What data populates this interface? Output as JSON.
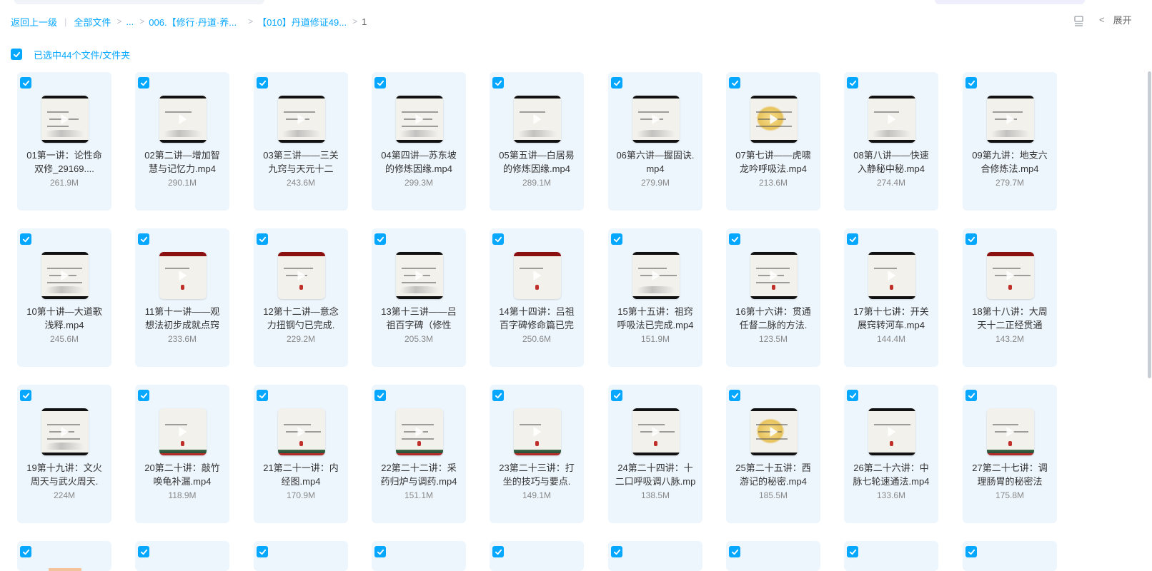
{
  "breadcrumb": {
    "back": "返回上一级",
    "all_files": "全部文件",
    "ellipsis": "...",
    "folder1": "006.【修行·丹道·养...",
    "folder2": "【010】丹道修证49...",
    "current": "1"
  },
  "header": {
    "expand_label": "展开",
    "view_icon": "list-view-icon"
  },
  "selection": {
    "text": "已选中44个文件/文件夹"
  },
  "colors": {
    "accent": "#06a7ff",
    "tile_bg": "#eef6fd"
  },
  "files": [
    {
      "name": "01第一讲：论性命双修_29169....",
      "size": "261.9M",
      "style": "plain"
    },
    {
      "name": "02第二讲—增加智慧与记忆力.mp4",
      "size": "290.1M",
      "style": "plain"
    },
    {
      "name": "03第三讲——三关九窍与天元十二",
      "size": "243.6M",
      "style": "plain"
    },
    {
      "name": "04第四讲—苏东坡的修炼因缘.mp4",
      "size": "299.3M",
      "style": "plain"
    },
    {
      "name": "05第五讲—白居易的修炼因缘.mp4",
      "size": "289.1M",
      "style": "plain"
    },
    {
      "name": "06第六讲—握固诀.mp4",
      "size": "279.9M",
      "style": "plain"
    },
    {
      "name": "07第七讲——虎啸龙吟呼吸法.mp4",
      "size": "213.6M",
      "style": "gold"
    },
    {
      "name": "08第八讲——快速入静秘中秘.mp4",
      "size": "274.4M",
      "style": "plain"
    },
    {
      "name": "09第九讲：地支六合修炼法.mp4",
      "size": "279.7M",
      "style": "plain"
    },
    {
      "name": "10第十讲—大道歌浅释.mp4",
      "size": "245.6M",
      "style": "plain"
    },
    {
      "name": "11第十一讲——观想法初步成就点窍",
      "size": "233.6M",
      "style": "red"
    },
    {
      "name": "12第十二讲—意念力扭钢勺已完成.",
      "size": "229.2M",
      "style": "red"
    },
    {
      "name": "13第十三讲——吕祖百字碑（修性",
      "size": "205.3M",
      "style": "plain"
    },
    {
      "name": "14第十四讲：吕祖百字碑修命篇已完",
      "size": "250.6M",
      "style": "red"
    },
    {
      "name": "15第十五讲：祖窍呼吸法已完成.mp4",
      "size": "151.9M",
      "style": "plain"
    },
    {
      "name": "16第十六讲：贯通任督二脉的方法.",
      "size": "123.5M",
      "style": "white"
    },
    {
      "name": "17第十七讲：开关展窍转河车.mp4",
      "size": "144.4M",
      "style": "white"
    },
    {
      "name": "18第十八讲：大周天十二正经贯通",
      "size": "143.2M",
      "style": "red"
    },
    {
      "name": "19第十九讲：文火周天与武火周天.",
      "size": "224M",
      "style": "plain"
    },
    {
      "name": "20第二十讲：敲竹唤龟补漏.mp4",
      "size": "118.9M",
      "style": "pagoda"
    },
    {
      "name": "21第二十一讲：内经图.mp4",
      "size": "170.9M",
      "style": "pagoda"
    },
    {
      "name": "22第二十二讲：采药归炉与调药.mp4",
      "size": "151.1M",
      "style": "pagoda"
    },
    {
      "name": "23第二十三讲：打坐的技巧与要点.",
      "size": "149.1M",
      "style": "pagoda"
    },
    {
      "name": "24第二十四讲：十二口呼吸调八脉.mp4",
      "size": "138.5M",
      "style": "white"
    },
    {
      "name": "25第二十五讲：西游记的秘密.mp4",
      "size": "185.5M",
      "style": "gold"
    },
    {
      "name": "26第二十六讲：中脉七轮速通法.mp4",
      "size": "133.6M",
      "style": "white"
    },
    {
      "name": "27第二十七讲：调理肠胃的秘密法",
      "size": "175.8M",
      "style": "pagoda"
    }
  ],
  "partial_row_count": 9
}
